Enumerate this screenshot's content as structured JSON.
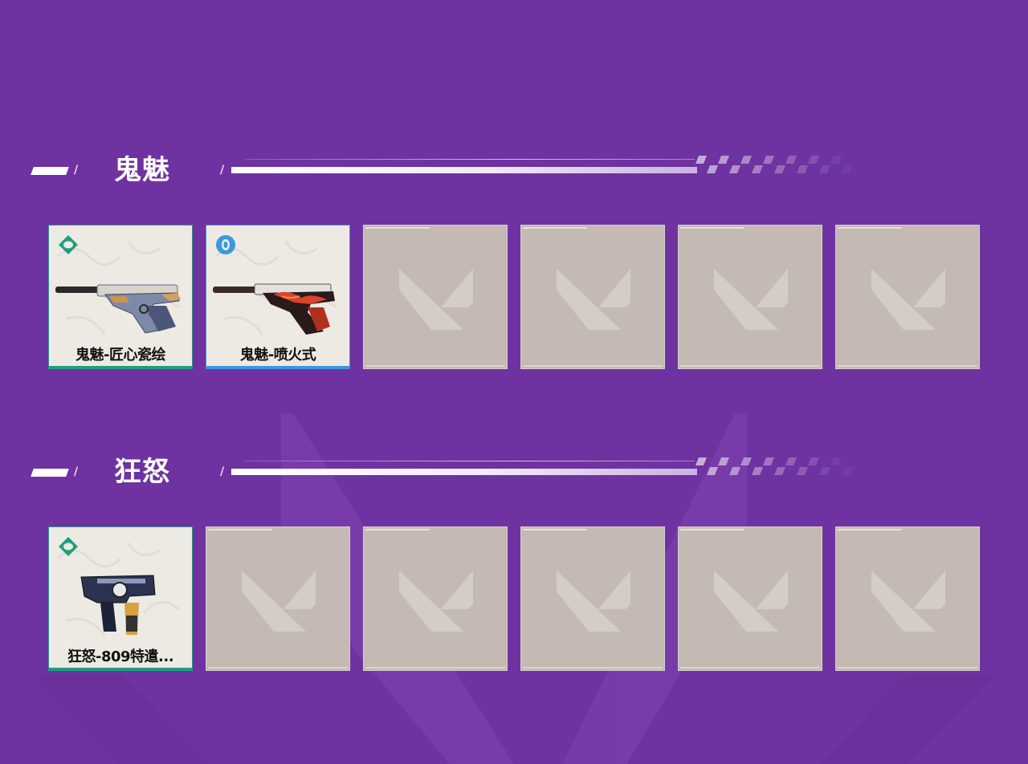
{
  "sections": [
    {
      "title": "鬼魅",
      "items": [
        {
          "name": "鬼魅-匠心瓷绘",
          "tier_color": "#1f9e80",
          "tier_icon": "select-tier-icon",
          "weapon": "ghost-pistol"
        },
        {
          "name": "鬼魅-喷火式",
          "tier_color": "#3a98e0",
          "tier_icon": "deluxe-tier-icon",
          "weapon": "ghost-pistol"
        },
        {
          "name": ""
        },
        {
          "name": ""
        },
        {
          "name": ""
        },
        {
          "name": ""
        }
      ]
    },
    {
      "title": "狂怒",
      "items": [
        {
          "name": "狂怒-809特遣...",
          "tier_color": "#1f9e80",
          "tier_icon": "select-tier-icon",
          "weapon": "frenzy-pistol"
        },
        {
          "name": ""
        },
        {
          "name": ""
        },
        {
          "name": ""
        },
        {
          "name": ""
        },
        {
          "name": ""
        }
      ]
    }
  ],
  "colors": {
    "background": "#6e33a0",
    "empty_tile": "#c4bab3",
    "filled_tile": "#edeae4",
    "select_tier": "#1f9e80",
    "deluxe_tier": "#3a98e0"
  },
  "icons": {
    "empty_slot": "valorant-logo-icon",
    "header_checker": "checkered-flag-pattern"
  }
}
